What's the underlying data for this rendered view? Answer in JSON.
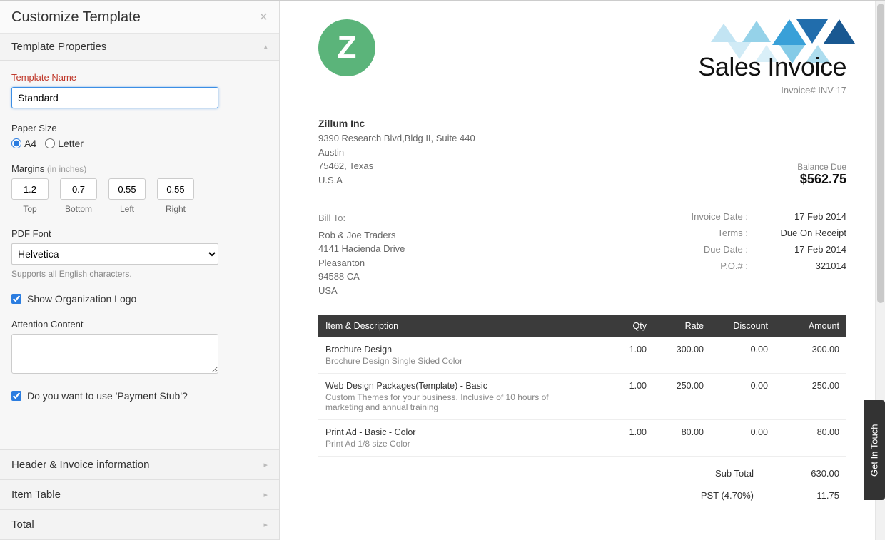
{
  "sidebar": {
    "title": "Customize Template",
    "sections": {
      "properties": "Template Properties",
      "header_info": "Header & Invoice information",
      "item_table": "Item Table",
      "total": "Total"
    },
    "template_name_label": "Template Name",
    "template_name_value": "Standard",
    "paper_size_label": "Paper Size",
    "paper_a4": "A4",
    "paper_letter": "Letter",
    "margins_label": "Margins",
    "margins_hint": "(in inches)",
    "margins": {
      "top": "1.2",
      "bottom": "0.7",
      "left": "0.55",
      "right": "0.55"
    },
    "margin_labels": {
      "top": "Top",
      "bottom": "Bottom",
      "left": "Left",
      "right": "Right"
    },
    "pdf_font_label": "PDF Font",
    "pdf_font_value": "Helvetica",
    "pdf_font_helper": "Supports all English characters.",
    "show_logo_label": "Show Organization Logo",
    "attention_label": "Attention Content",
    "payment_stub_label": "Do you want to use 'Payment Stub'?"
  },
  "invoice": {
    "logo_letter": "Z",
    "title": "Sales Invoice",
    "number_label": "Invoice# INV-17",
    "company": {
      "name": "Zillum Inc",
      "line1": "9390 Research Blvd,Bldg II, Suite 440",
      "city": "Austin",
      "region": "75462, Texas",
      "country": "U.S.A"
    },
    "balance_label": "Balance Due",
    "balance_value": "$562.75",
    "bill_to_label": "Bill To:",
    "bill_to": {
      "name": "Rob & Joe Traders",
      "line1": "4141 Hacienda Drive",
      "city": "Pleasanton",
      "region": "94588 CA",
      "country": "USA"
    },
    "meta": [
      {
        "k": "Invoice Date :",
        "v": "17 Feb 2014"
      },
      {
        "k": "Terms :",
        "v": "Due On Receipt"
      },
      {
        "k": "Due Date :",
        "v": "17 Feb 2014"
      },
      {
        "k": "P.O.# :",
        "v": "321014"
      }
    ],
    "columns": {
      "item": "Item & Description",
      "qty": "Qty",
      "rate": "Rate",
      "discount": "Discount",
      "amount": "Amount"
    },
    "items": [
      {
        "name": "Brochure Design",
        "desc": "Brochure Design Single Sided Color",
        "qty": "1.00",
        "rate": "300.00",
        "discount": "0.00",
        "amount": "300.00"
      },
      {
        "name": "Web Design Packages(Template) - Basic",
        "desc": "Custom Themes for your business. Inclusive of 10 hours of marketing and annual training",
        "qty": "1.00",
        "rate": "250.00",
        "discount": "0.00",
        "amount": "250.00"
      },
      {
        "name": "Print Ad - Basic - Color",
        "desc": "Print Ad 1/8 size Color",
        "qty": "1.00",
        "rate": "80.00",
        "discount": "0.00",
        "amount": "80.00"
      }
    ],
    "totals": [
      {
        "label": "Sub Total",
        "value": "630.00"
      },
      {
        "label": "PST (4.70%)",
        "value": "11.75"
      }
    ]
  },
  "touch_tab": "Get In Touch"
}
